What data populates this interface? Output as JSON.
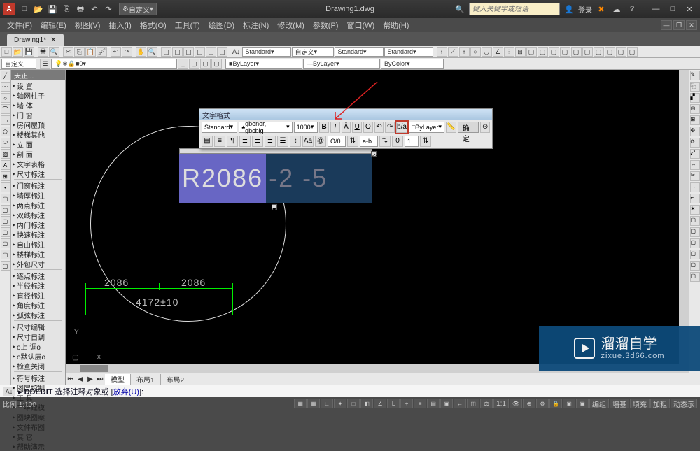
{
  "app": {
    "logo_letter": "A",
    "title": "Drawing1.dwg",
    "search_placeholder": "键入关键字或短语",
    "login_label": "登录"
  },
  "qat_icons": [
    "new",
    "open",
    "save",
    "undo",
    "redo",
    "plot"
  ],
  "workspace_drop": "自定义",
  "menus": [
    "文件(F)",
    "编辑(E)",
    "视图(V)",
    "插入(I)",
    "格式(O)",
    "工具(T)",
    "绘图(D)",
    "标注(N)",
    "修改(M)",
    "参数(P)",
    "窗口(W)",
    "帮助(H)"
  ],
  "doc_tab": "Drawing1*",
  "toolbar2": {
    "style_label": "A↓",
    "style_drops": [
      "Standard",
      "自定义",
      "Standard",
      "Standard"
    ]
  },
  "toolbar3": {
    "left_label": "自定义",
    "layer_drop": "0",
    "line_drops": [
      "ByLayer",
      "ByLayer",
      "ByColor"
    ]
  },
  "sidebar": {
    "title": "天正...",
    "items": [
      "设  置",
      "轴网柱子",
      "墙  体",
      "门  窗",
      "房间屋顶",
      "楼梯其他",
      "立  面",
      "剖  面",
      "文字表格",
      "尺寸标注",
      "门窗标注",
      "墙厚标注",
      "两点标注",
      "双线标注",
      "内门标注",
      "快速标注",
      "自由标注",
      "楼梯标注",
      "外包尺寸",
      "逐点标注",
      "半径标注",
      "直径标注",
      "角度标注",
      "弧弦标注",
      "尺寸编辑",
      "尺寸自调",
      "o上 调o",
      "o默认层o",
      "检查关闭",
      "符号标注",
      "图层控制",
      "工  具",
      "三维建模",
      "图块图案",
      "文件布图",
      "其  它",
      "帮助演示"
    ],
    "dividers_after": [
      9,
      18,
      23,
      28
    ]
  },
  "mtext_toolbar": {
    "window_title": "文字格式",
    "style_drop": "Standard",
    "font_drop": "gbenor, gbcbig",
    "size_drop": "1000",
    "format_btns": [
      "B",
      "I",
      "Ā",
      "U",
      "O",
      "↶",
      "↷"
    ],
    "stack_btn": "b/a",
    "color_drop": "ByLayer",
    "ok_label": "确定",
    "row2_at": "@",
    "row2_oo": "O/0",
    "row2_ab": "a-b",
    "row2_o": "0",
    "row2_spin": "1"
  },
  "mtext_content": {
    "selected": "R2086",
    "rest": "-2 -5"
  },
  "dimensions": {
    "half1": "2086",
    "half2": "2086",
    "total": "4172±10"
  },
  "ucs": {
    "x": "X",
    "y": "Y"
  },
  "layout_tabs": {
    "model": "模型",
    "l1": "布局1",
    "l2": "布局2"
  },
  "command": {
    "prefix": "DDEDIT",
    "body": " 选择注释对象或 [",
    "opt": "放弃(U)",
    "suffix": "]:"
  },
  "status": {
    "scale": "比例 1:100",
    "right_items": [
      "1:1",
      "编组",
      "墙基",
      "填充",
      "加粗",
      "动态示"
    ]
  },
  "watermark": {
    "brand": "溜溜自学",
    "url": "zixue.3d66.com"
  }
}
